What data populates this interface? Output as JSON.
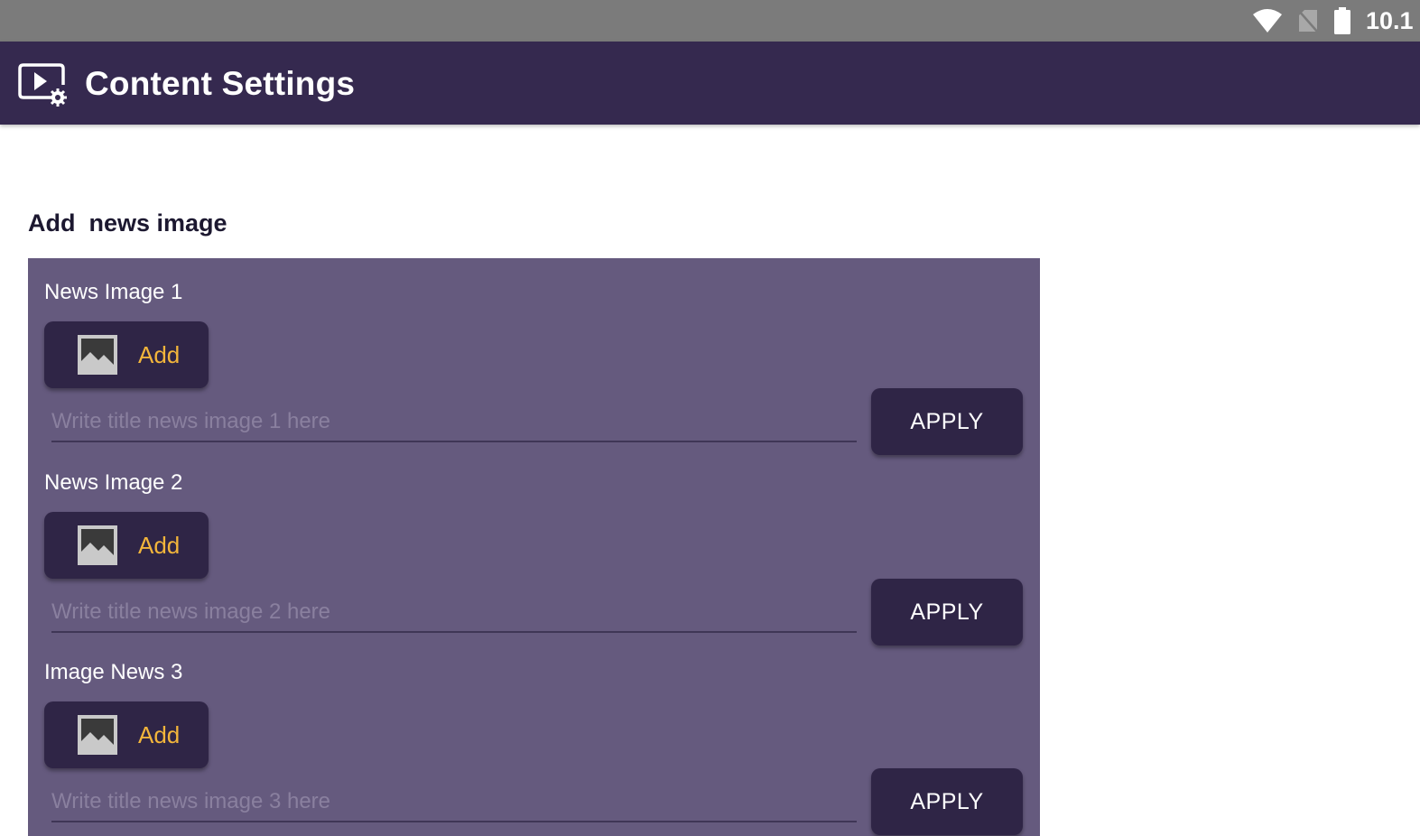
{
  "status_bar": {
    "time": "10.1",
    "icons": [
      "wifi-icon",
      "no-sim-icon",
      "battery-icon"
    ]
  },
  "app_bar": {
    "title": "Content Settings",
    "icon": "video-settings-icon"
  },
  "section": {
    "heading": "Add  news image"
  },
  "items": [
    {
      "label": "News Image 1",
      "add_label": "Add",
      "placeholder": "Write title news image 1 here",
      "apply_label": "APPLY"
    },
    {
      "label": "News Image 2",
      "add_label": "Add",
      "placeholder": "Write title news image 2 here",
      "apply_label": "APPLY"
    },
    {
      "label": "Image News 3",
      "add_label": "Add",
      "placeholder": "Write title news image 3 here",
      "apply_label": "APPLY"
    }
  ],
  "colors": {
    "status_bar": "#7b7b7b",
    "app_bar": "#35294f",
    "panel": "#655a7e",
    "button": "#2f2546",
    "add_text": "#f2b53b"
  }
}
